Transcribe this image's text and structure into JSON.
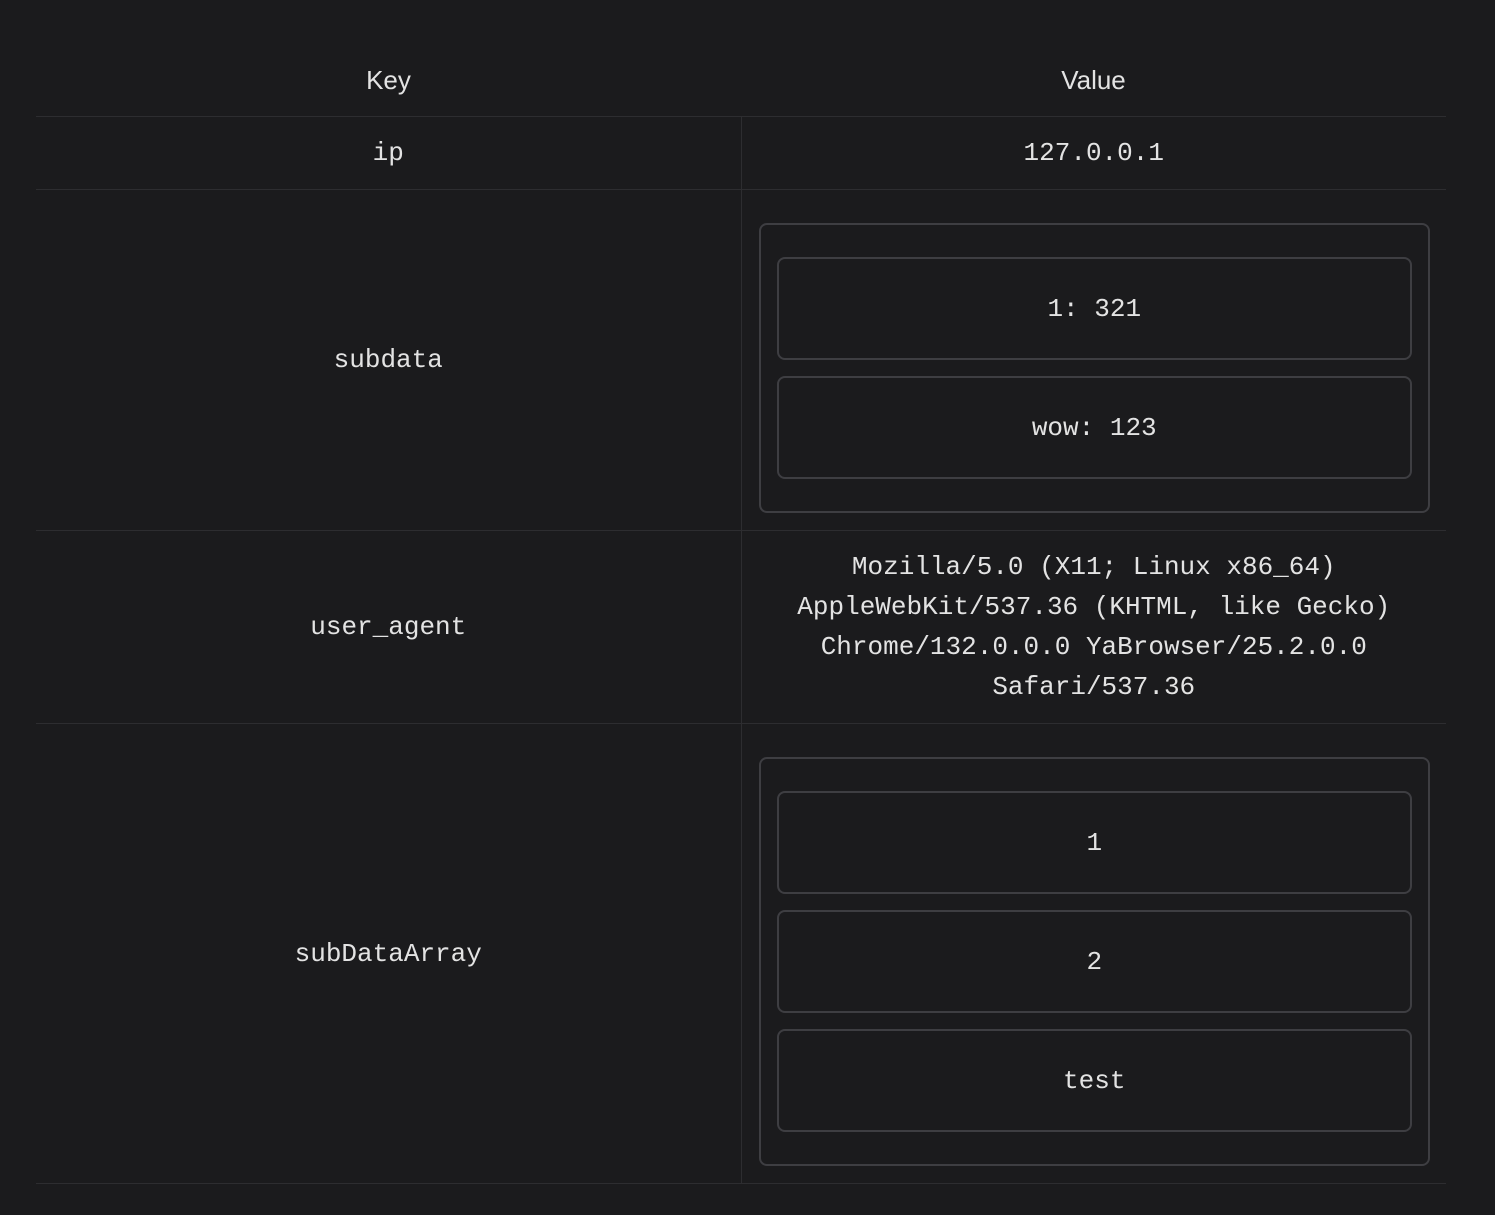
{
  "table": {
    "headers": {
      "key": "Key",
      "value": "Value"
    },
    "rows": [
      {
        "key": "ip",
        "value": "127.0.0.1"
      },
      {
        "key": "subdata",
        "items": [
          "1:  321",
          "wow:  123"
        ]
      },
      {
        "key": "user_agent",
        "value": "Mozilla/5.0 (X11; Linux x86_64) AppleWebKit/537.36 (KHTML, like Gecko) Chrome/132.0.0.0 YaBrowser/25.2.0.0 Safari/537.36"
      },
      {
        "key": "subDataArray",
        "items": [
          "1",
          "2",
          "test"
        ]
      }
    ]
  },
  "colors": {
    "background": "#1b1b1d",
    "text": "#e3e3e3",
    "border": "#3e3e42",
    "row_divider": "#2d2d30"
  }
}
